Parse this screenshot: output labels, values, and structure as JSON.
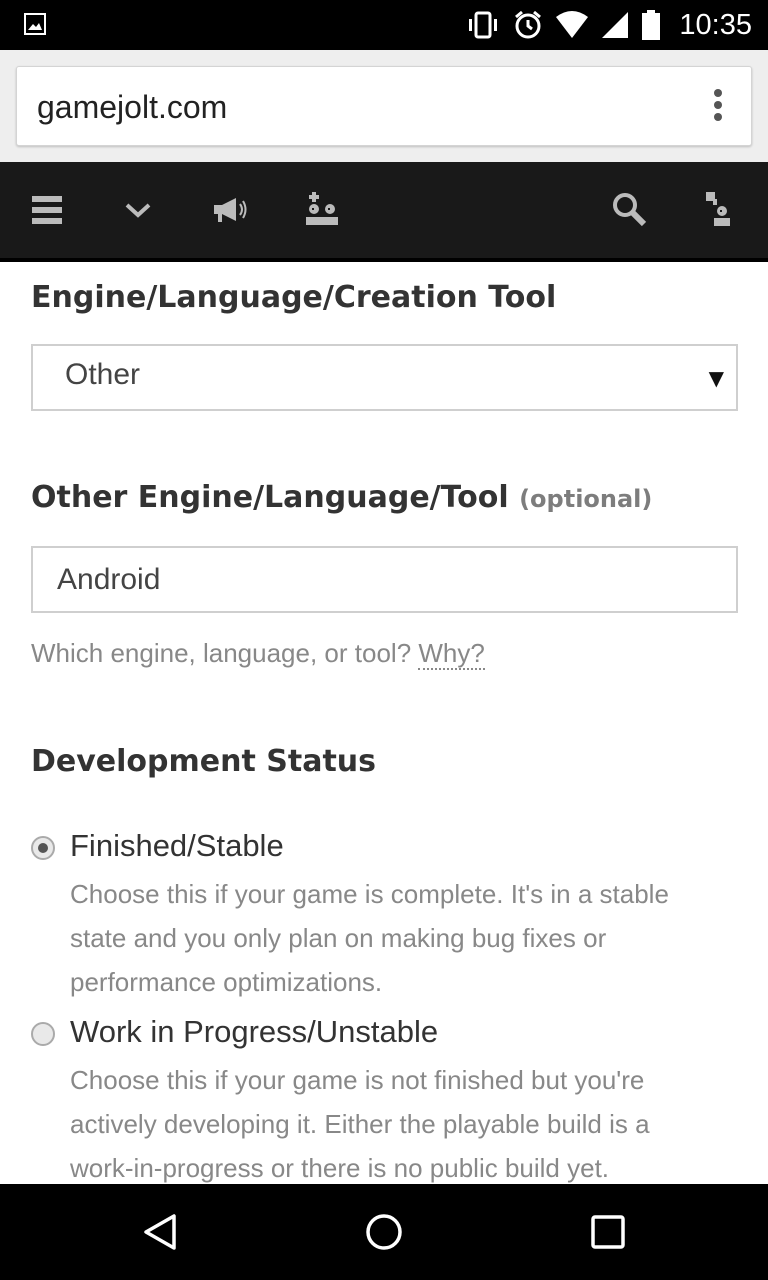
{
  "status_bar": {
    "time": "10:35",
    "icons": [
      "image-icon",
      "vibrate-icon",
      "alarm-icon",
      "wifi-icon",
      "signal-icon",
      "battery-icon"
    ]
  },
  "browser": {
    "url": "gamejolt.com"
  },
  "site_nav": {
    "icons": [
      "menu-icon",
      "chevron-down-icon",
      "megaphone-icon",
      "users-add-icon",
      "search-icon",
      "user-icon"
    ]
  },
  "form": {
    "engine_label": "Engine/Language/Creation Tool",
    "engine_selected": "Other",
    "other_engine_label": "Other Engine/Language/Tool",
    "other_engine_optional": "(optional)",
    "other_engine_value": "Android",
    "other_engine_help": "Which engine, language, or tool?",
    "other_engine_help_link": "Why?",
    "dev_status_label": "Development Status",
    "options": [
      {
        "title": "Finished/Stable",
        "description": "Choose this if your game is complete. It's in a stable state and you only plan on making bug fixes or performance optimizations.",
        "checked": true
      },
      {
        "title": "Work in Progress/Unstable",
        "description": "Choose this if your game is not finished but you're actively developing it. Either the playable build is a work-in-progress or there is no public build yet.",
        "checked": false
      }
    ]
  },
  "android_nav": {
    "icons": [
      "back-icon",
      "home-icon",
      "recents-icon"
    ]
  }
}
